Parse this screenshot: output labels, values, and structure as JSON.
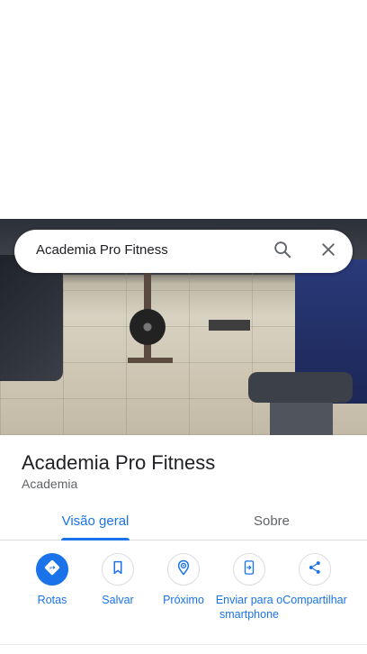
{
  "search": {
    "query": "Academia Pro Fitness",
    "search_icon": "search-icon",
    "close_icon": "close-icon"
  },
  "place": {
    "name": "Academia Pro Fitness",
    "category": "Academia"
  },
  "tabs": [
    {
      "label": "Visão geral",
      "selected": true
    },
    {
      "label": "Sobre",
      "selected": false
    }
  ],
  "actions": [
    {
      "label": "Rotas",
      "icon": "directions-icon"
    },
    {
      "label": "Salvar",
      "icon": "bookmark-icon"
    },
    {
      "label": "Próximo",
      "icon": "nearby-icon"
    },
    {
      "label": "Enviar para o smartphone",
      "icon": "send-to-phone-icon"
    },
    {
      "label": "Compartilhar",
      "icon": "share-icon"
    }
  ],
  "colors": {
    "accent": "#1a73e8",
    "text_primary": "#202124",
    "text_secondary": "#5f6368"
  }
}
